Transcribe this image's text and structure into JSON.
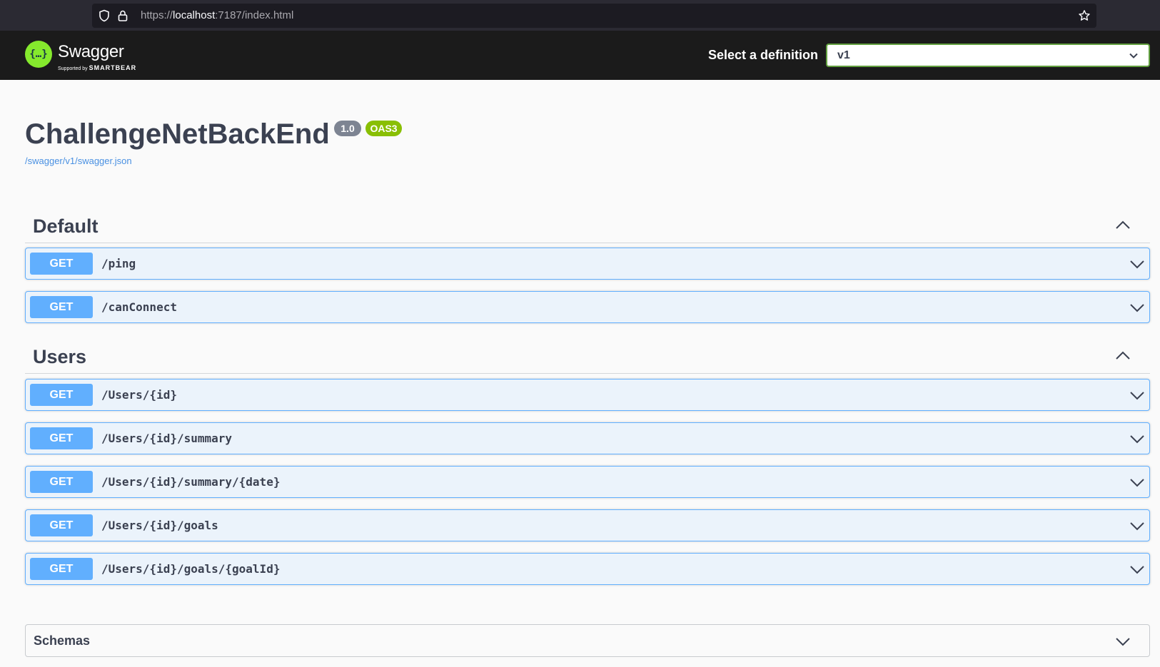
{
  "browser": {
    "url_prefix": "https://",
    "url_host": "localhost",
    "url_rest": ":7187/index.html"
  },
  "topbar": {
    "logo_name": "Swagger",
    "logo_symbol": "{…}",
    "logo_sub_prefix": "Supported by",
    "logo_sub_brand": "SMARTBEAR",
    "definition_label": "Select a definition",
    "definition_value": "v1"
  },
  "info": {
    "title": "ChallengeNetBackEnd",
    "version_badge": "1.0",
    "oas_badge": "OAS3",
    "spec_link": "/swagger/v1/swagger.json"
  },
  "tags": [
    {
      "name": "Default",
      "operations": [
        {
          "method": "GET",
          "path": "/ping"
        },
        {
          "method": "GET",
          "path": "/canConnect"
        }
      ]
    },
    {
      "name": "Users",
      "operations": [
        {
          "method": "GET",
          "path": "/Users/{id}"
        },
        {
          "method": "GET",
          "path": "/Users/{id}/summary"
        },
        {
          "method": "GET",
          "path": "/Users/{id}/summary/{date}"
        },
        {
          "method": "GET",
          "path": "/Users/{id}/goals"
        },
        {
          "method": "GET",
          "path": "/Users/{id}/goals/{goalId}"
        }
      ]
    }
  ],
  "schemas": {
    "title": "Schemas"
  },
  "colors": {
    "get_method": "#61affe",
    "get_background": "#ebf3fb",
    "topbar": "#1b1b1b",
    "logo_green": "#85ea2d",
    "oas_badge": "#89bf04",
    "version_badge": "#7d8492",
    "text": "#3b4151"
  },
  "icons": {
    "shield": "shield-icon",
    "lock": "lock-icon",
    "star": "star-icon",
    "chevron_down": "chevron-down-icon",
    "chevron_up": "chevron-up-icon"
  }
}
